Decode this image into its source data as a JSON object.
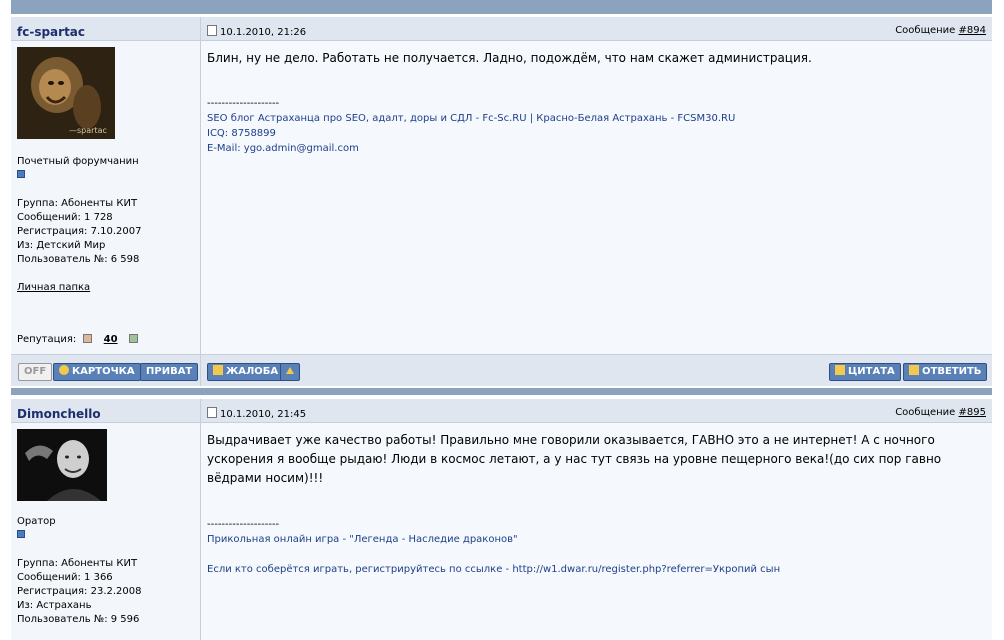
{
  "posts": [
    {
      "author": "fc-spartac",
      "avatar_caption": "—spartac",
      "date": "10.1.2010, 21:26",
      "message_label": "Сообщение",
      "message_number": "#894",
      "rank": "Почетный форумчанин",
      "group": "Группа: Абоненты КИТ",
      "messages": "Сообщений: 1 728",
      "registration": "Регистрация: 7.10.2007",
      "from": "Из: Детский Мир",
      "user_number": "Пользователь №: 6 598",
      "personal_folder": "Личная папка",
      "reputation_label": "Репутация:",
      "reputation_value": "40",
      "body": "Блин, ну не дело. Работать не получается. Ладно, подождём, что нам скажет администрация.",
      "signature_dash": "--------------------",
      "signature_lines": [
        "SEO блог Астраханца про SEO, адалт, доры и СДЛ - Fc-Sc.RU | Красно-Белая Астрахань - FCSM30.RU",
        "ICQ: 8758899",
        "E-Mail: ygo.admin@gmail.com"
      ],
      "buttons": {
        "off": "OFF",
        "card": "КАРТОЧКА",
        "private": "ПРИВАТ",
        "complaint": "ЖАЛОБА",
        "quote": "ЦИТАТА",
        "reply": "ОТВЕТИТЬ"
      }
    },
    {
      "author": "Dimonchello",
      "date": "10.1.2010, 21:45",
      "message_label": "Сообщение",
      "message_number": "#895",
      "rank": "Оратор",
      "group": "Группа: Абоненты КИТ",
      "messages": "Сообщений: 1 366",
      "registration": "Регистрация: 23.2.2008",
      "from": "Из: Астрахань",
      "user_number": "Пользователь №: 9 596",
      "body": "Выдрачивает уже качество работы! Правильно мне говорили оказывается, ГАВНО это а не интернет! А с ночного ускорения я вообще рыдаю! Люди в космос летают, а у нас тут связь на уровне пещерного века!(до сих пор гавно вёдрами носим)!!!",
      "signature_dash": "--------------------",
      "signature_lines": [
        "Прикольная онлайн игра - \"Легенда - Наследие драконов\"",
        "",
        "Если кто соберётся играть, регистрируйтесь по ссылке - http://w1.dwar.ru/register.php?referrer=Укропий сын"
      ]
    }
  ],
  "colors": {
    "header_bg": "#dfe6ef",
    "separator": "#8ba3bd",
    "button_bg": "#5a80b8",
    "author_color": "#1e2f6e",
    "signature_color": "#1e3f8a"
  }
}
